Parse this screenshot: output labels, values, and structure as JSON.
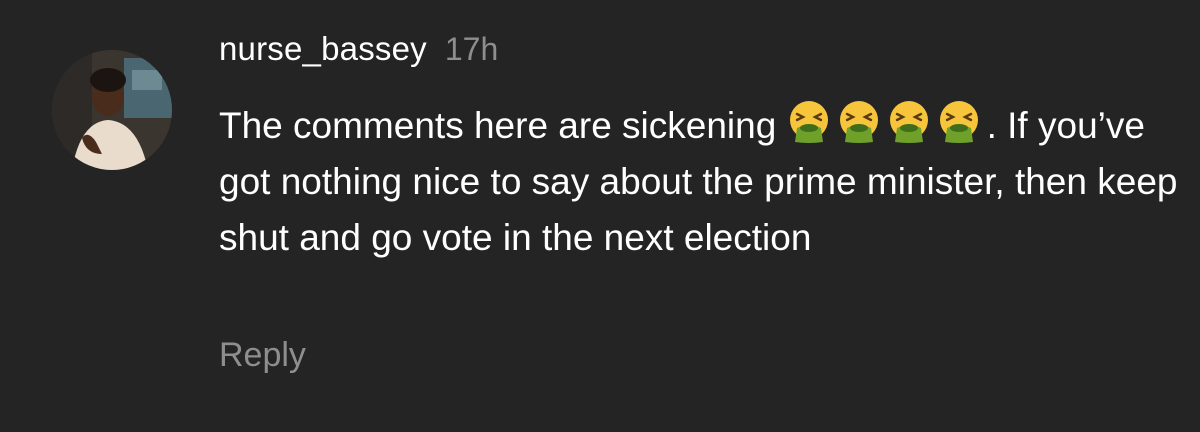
{
  "comment": {
    "username": "nurse_bassey",
    "timestamp": "17h",
    "text_part1": "The comments here are sickening ",
    "text_part2": ". If you’ve got nothing nice to say about the prime minister, then keep shut and go vote in the next election",
    "emoji_icon": "face-vomiting-icon",
    "reply_label": "Reply"
  },
  "colors": {
    "background": "#242424",
    "text": "#ffffff",
    "muted": "#8e8e8e"
  }
}
